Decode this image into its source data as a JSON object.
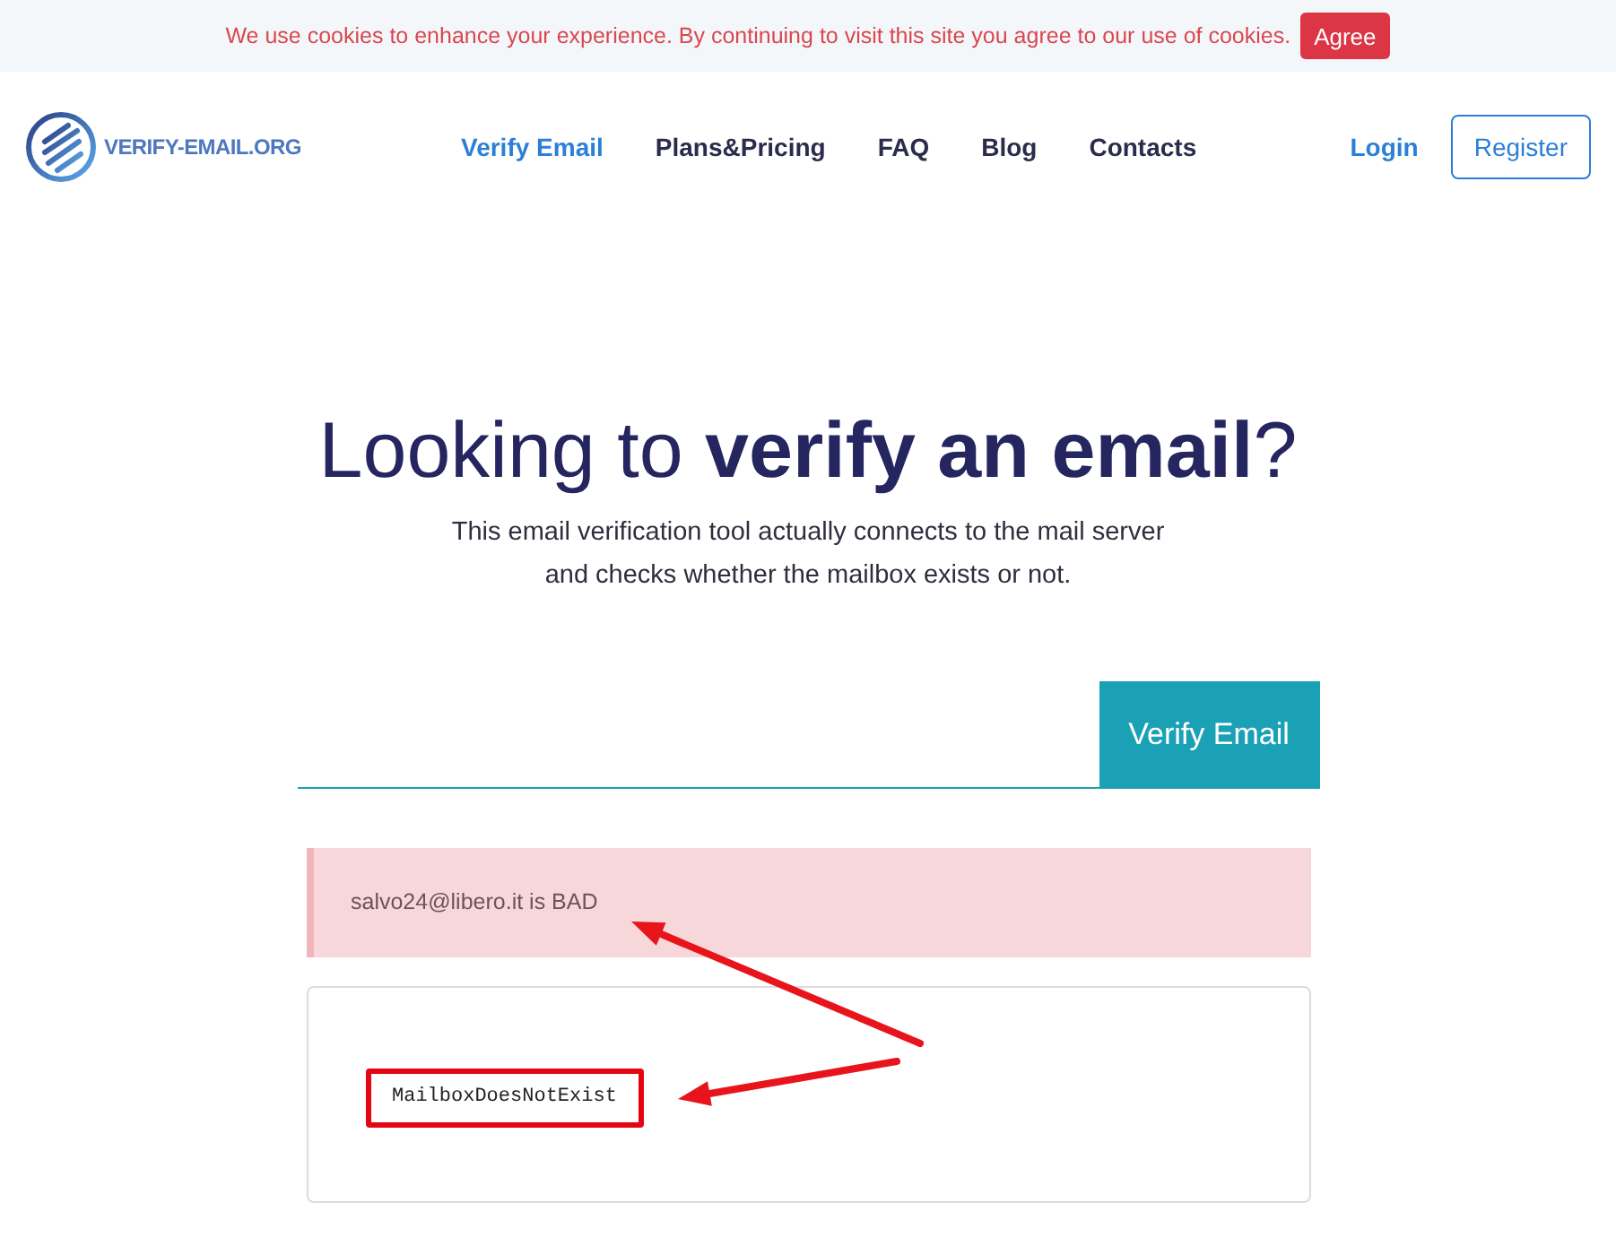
{
  "cookie_bar": {
    "message": "We use cookies to enhance your experience. By continuing to visit this site you agree to our use of cookies.",
    "button": "Agree"
  },
  "nav": {
    "logo_text": "VERIFY-EMAIL.ORG",
    "links": [
      {
        "label": "Verify Email",
        "selected": true
      },
      {
        "label": "Plans&Pricing",
        "selected": false
      },
      {
        "label": "FAQ",
        "selected": false
      },
      {
        "label": "Blog",
        "selected": false
      },
      {
        "label": "Contacts",
        "selected": false
      }
    ],
    "login": "Login",
    "register": "Register"
  },
  "hero": {
    "title": "Looking to **verify an email**?",
    "subtitle": [
      "This email verification tool actually connects to the mail server",
      "and checks whether the mailbox exists or not."
    ]
  },
  "form": {
    "button": "Verify Email"
  },
  "result": {
    "status": "salvo24@libero.it is BAD",
    "detail": "MailboxDoesNotExist"
  }
}
